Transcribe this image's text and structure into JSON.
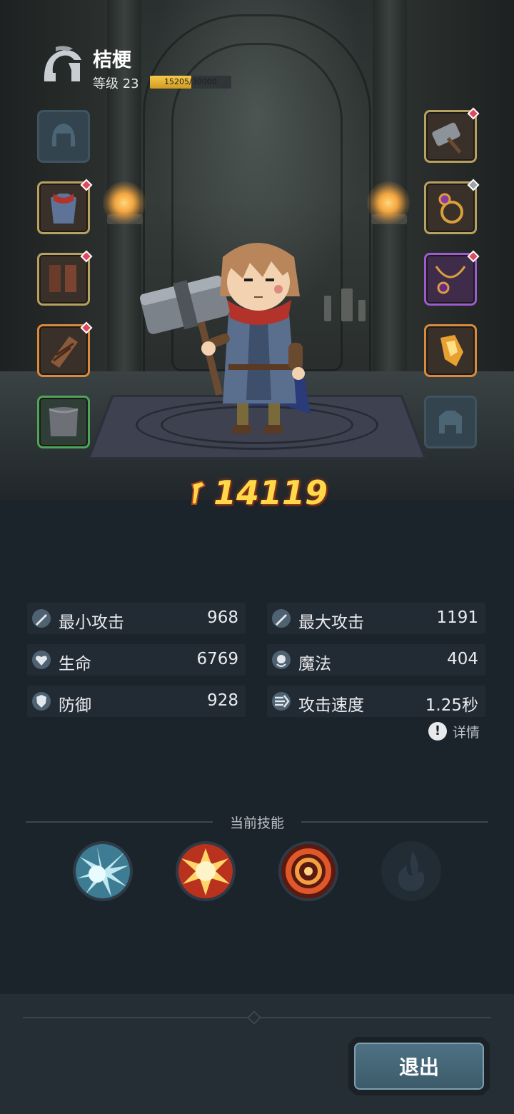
{
  "player": {
    "name": "桔梗",
    "level_label": "等级 23",
    "xp_text": "15205/30000",
    "xp_fraction": 0.507
  },
  "equipment": {
    "left": [
      {
        "name": "helmet",
        "empty": true
      },
      {
        "name": "chest-armor",
        "rarity": "gold"
      },
      {
        "name": "boots",
        "rarity": "gold"
      },
      {
        "name": "bracers",
        "rarity": "orange"
      },
      {
        "name": "pants",
        "rarity": "green"
      }
    ],
    "right": [
      {
        "name": "hammer",
        "rarity": "gold"
      },
      {
        "name": "ring",
        "rarity": "gold"
      },
      {
        "name": "necklace",
        "rarity": "purple"
      },
      {
        "name": "crystal",
        "rarity": "orange"
      },
      {
        "name": "pet",
        "empty": true
      }
    ]
  },
  "power": {
    "value": "14119",
    "color": "#ffd94a"
  },
  "stats": [
    {
      "label": "最小攻击",
      "value": "968",
      "icon": "sword-icon"
    },
    {
      "label": "最大攻击",
      "value": "1191",
      "icon": "sword-icon"
    },
    {
      "label": "生命",
      "value": "6769",
      "icon": "heart-icon"
    },
    {
      "label": "魔法",
      "value": "404",
      "icon": "magic-icon"
    },
    {
      "label": "防御",
      "value": "928",
      "icon": "shield-icon"
    },
    {
      "label": "攻击速度",
      "value": "1.25秒",
      "icon": "speed-icon"
    }
  ],
  "details_label": "详情",
  "skills": {
    "title": "当前技能",
    "items": [
      {
        "name": "ice-burst-skill",
        "locked": false
      },
      {
        "name": "explosion-skill",
        "locked": false
      },
      {
        "name": "fire-vortex-skill",
        "locked": false
      },
      {
        "name": "flame-skill",
        "locked": true
      }
    ]
  },
  "exit_label": "退出"
}
